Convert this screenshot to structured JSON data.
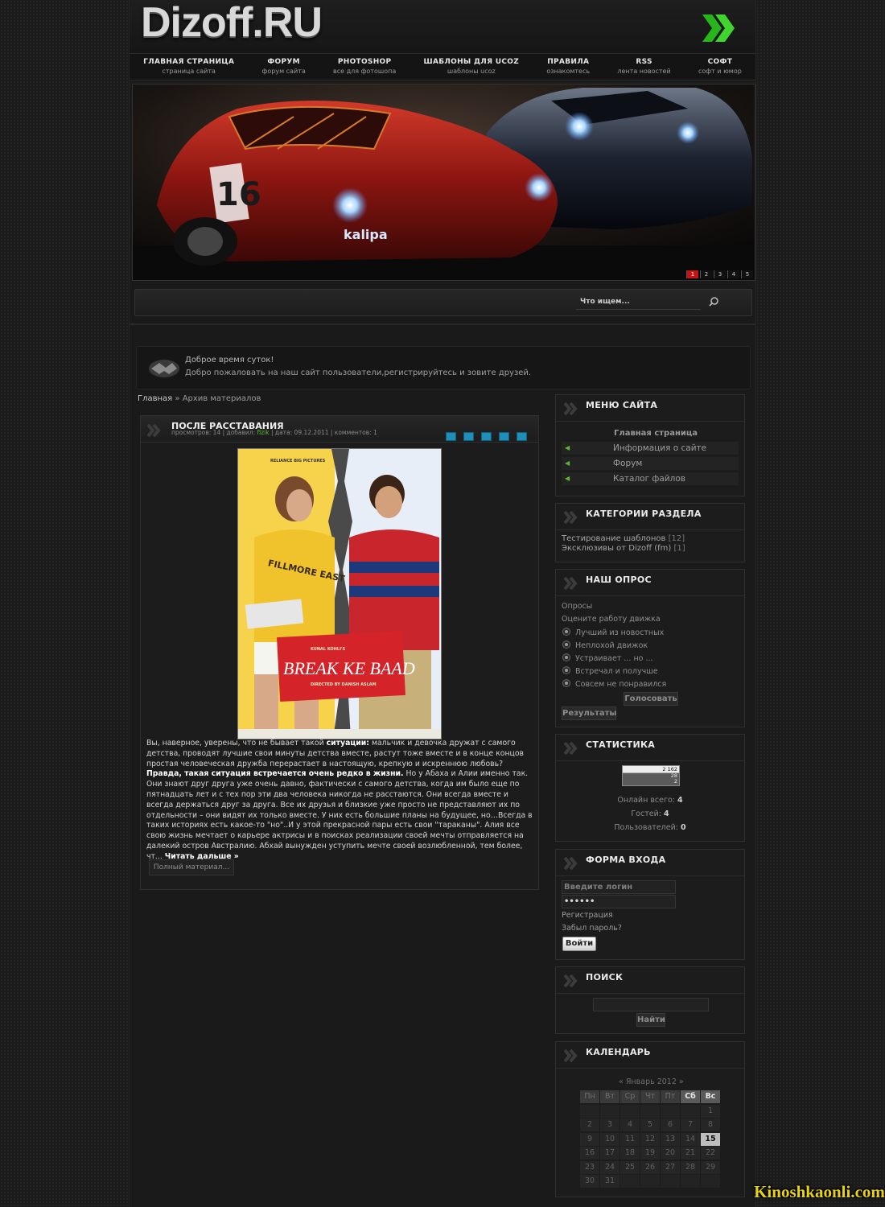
{
  "header": {
    "logo_text": "Dizoff.RU",
    "nav": [
      {
        "title": "ГЛАВНАЯ СТРАНИЦА",
        "sub": "страница сайта"
      },
      {
        "title": "ФОРУМ",
        "sub": "форум сайта"
      },
      {
        "title": "PHOTOSHOP",
        "sub": "все для фотошопа"
      },
      {
        "title": "ШАБЛОНЫ ДЛЯ UCOZ",
        "sub": "шаблоны ucoz"
      },
      {
        "title": "ПРАВИЛА",
        "sub": "ознакомтесь"
      },
      {
        "title": "RSS",
        "sub": "лента новостей"
      },
      {
        "title": "СОФТ",
        "sub": "софт и юмор"
      }
    ]
  },
  "banner": {
    "brand": "kalipa",
    "brand2": "kalipa",
    "car_number": "16",
    "pages": [
      "1",
      "2",
      "3",
      "4",
      "5"
    ]
  },
  "search_bar": {
    "placeholder": "Что ищем..."
  },
  "welcome": {
    "line1": "Доброе время суток!",
    "line2": "Добро пожаловать на наш сайт пользователи,регистрируйтесь и зовите друзей."
  },
  "breadcrumb": {
    "home": "Главная",
    "sep": " » ",
    "current": "Архив материалов"
  },
  "post": {
    "title": "ПОСЛЕ РАССТАВАНИЯ",
    "meta_views": "просмотров: 14",
    "meta_sep1": " | добавил: ",
    "meta_author": "fizik",
    "meta_rest": " | дата: 09.12.2011 | комментов: 1",
    "poster": {
      "top_left": "RELIANCE BIG PICTURES",
      "top_small": "KUNAL KOHLI'S",
      "title_main": "BREAK KE BAAD",
      "director": "DIRECTED BY DANISH ASLAM",
      "shirt": "FILLMORE EAST"
    },
    "text_a": "Вы, наверное, уверены, что не бывает такой ",
    "text_b": "ситуации:",
    "text_c": " мальчик и девочка дружат с самого детства, проводят лучшие свои минуты детства вместе, растут тоже вместе и в конце концов простая человеческая дружба перерастает в настоящую, крепкую и искреннюю любовь? ",
    "text_d": "Правда, такая ситуация встречается очень редко в жизни.",
    "text_e": " Но у Абаха и Алии именно так. Они знают друг друга уже очень давно, фактически с самого детства, когда им было еще по пятнадцать лет и с тех пор эти два человека никогда не расстаются. Они всегда вместе и всегда держаться друг за друга. Все их друзья и близкие уже просто не представляют их по отдельности – они видят их только вместе. У них есть большие планы на будущее, но…Всегда в таких историях есть какое-то \"но\"..И у этой прекрасной пары есть свои \"тараканы\". Алия все свою жизнь мечтает о карьере актрисы и в поисках реализации своей мечты отправляется на далекий остров Австралию. Абхай вынужден уступить мечте своей возлюбленной, тем более, чт... ",
    "read_more": "Читать дальше »",
    "full_button": "Полный материал..."
  },
  "sidebar": {
    "menu": {
      "title": "МЕНЮ САЙТА",
      "items": [
        "Главная страница",
        "Информация о сайте",
        "Форум",
        "Каталог файлов"
      ]
    },
    "categories": {
      "title": "КАТЕГОРИИ РАЗДЕЛА",
      "items": [
        {
          "name": "Тестирование шаблонов",
          "count": " [12]"
        },
        {
          "name": "Эксклюзивы от Dizoff (fm)",
          "count": " [1]"
        }
      ]
    },
    "poll": {
      "title": "НАШ ОПРОС",
      "label": "Опросы",
      "question": "Оцените работу движка",
      "options": [
        "Лучший из новостных",
        "Неплохой движок",
        "Устраивает ... но ...",
        "Встречал и получше",
        "Совсем не понравился"
      ],
      "vote": "Голосовать",
      "results": "Результаты"
    },
    "stats": {
      "title": "СТАТИСТИКА",
      "counter_value": "2 162",
      "counter_mid": "28",
      "counter_low": "2",
      "online_label": "Онлайн всего: ",
      "online": "4",
      "guests_label": "Гостей: ",
      "guests": "4",
      "users_label": "Пользователей: ",
      "users": "0"
    },
    "login": {
      "title": "ФОРМА ВХОДА",
      "login_placeholder": "Введите логин",
      "password_mask": "••••••",
      "register": "Регистрация",
      "forgot": "Забыл пароль?",
      "submit": "Войти"
    },
    "search": {
      "title": "ПОИСК",
      "button": "Найти"
    },
    "calendar": {
      "title": "КАЛЕНДАРЬ",
      "month": "«  Январь 2012  »",
      "days": [
        "Пн",
        "Вт",
        "Ср",
        "Чт",
        "Пт",
        "Сб",
        "Вс"
      ],
      "weeks": [
        [
          "",
          "",
          "",
          "",
          "",
          "",
          "1"
        ],
        [
          "2",
          "3",
          "4",
          "5",
          "6",
          "7",
          "8"
        ],
        [
          "9",
          "10",
          "11",
          "12",
          "13",
          "14",
          "15"
        ],
        [
          "16",
          "17",
          "18",
          "19",
          "20",
          "21",
          "22"
        ],
        [
          "23",
          "24",
          "25",
          "26",
          "27",
          "28",
          "29"
        ],
        [
          "30",
          "31",
          "",
          "",
          "",
          "",
          ""
        ]
      ],
      "today": "15"
    }
  },
  "watermark": "Kinoshkaonli.com",
  "colors": {
    "accent_green": "#5cb82e",
    "pager_active": "#c01515",
    "share_blue": "#1e8fb8",
    "watermark": "#e8d40c"
  }
}
